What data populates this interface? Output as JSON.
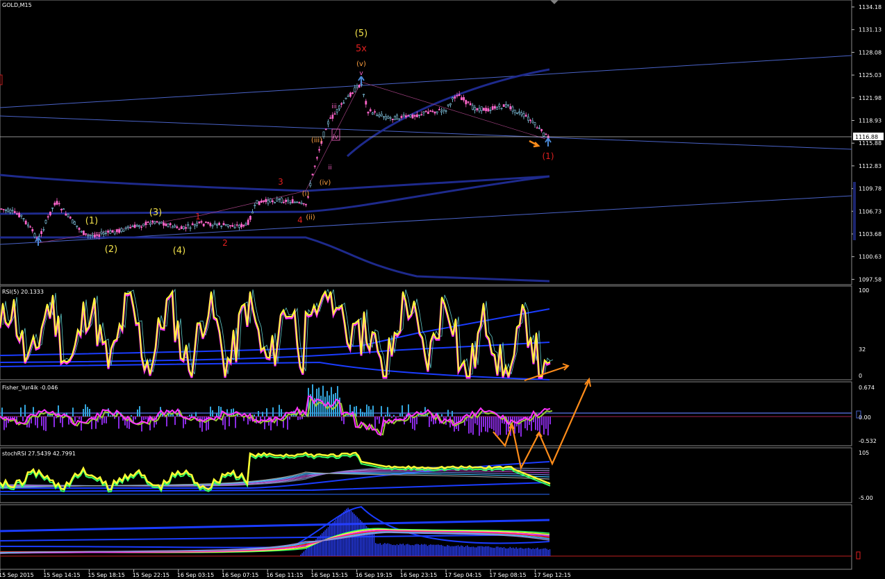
{
  "symbol_title": "GOLD,M15",
  "main_axis": [
    "1134.18",
    "1131.13",
    "1128.08",
    "1125.03",
    "1121.98",
    "1118.93",
    "1115.88",
    "1112.83",
    "1109.78",
    "1106.73",
    "1103.68",
    "1100.63",
    "1097.58"
  ],
  "current_price": "1116.88",
  "time_axis": [
    "15 Sep 2015",
    "15 Sep 14:15",
    "15 Sep 18:15",
    "15 Sep 22:15",
    "16 Sep 03:15",
    "16 Sep 07:15",
    "16 Sep 11:15",
    "16 Sep 15:15",
    "16 Sep 19:15",
    "16 Sep 23:15",
    "17 Sep 04:15",
    "17 Sep 08:15",
    "17 Sep 12:15"
  ],
  "rsi": {
    "title": "RSI(5) 20.1333",
    "axis": [
      "100",
      "32",
      "0"
    ]
  },
  "fisher": {
    "title": "Fisher_Yur4ik -0.046",
    "axis": [
      "0.674",
      "0.00",
      "-0.532"
    ]
  },
  "stochrsi": {
    "title": "stochRSI 27.5439 42.7991",
    "axis": [
      "105",
      "-5.00"
    ]
  },
  "wave_labels": {
    "y1": "(1)",
    "y2": "(2)",
    "y3": "(3)",
    "y4": "(4)",
    "y5": "(5)",
    "r5x": "5x",
    "o_v": "(v)",
    "o_iii": "(iii)",
    "o_iv": "(iv)",
    "o_i": "(i)",
    "o_ii": "(ii)",
    "p_iii": "iii",
    "p_iv": "iv",
    "p_ii": "ii",
    "p_v": "v",
    "p_vx": "v",
    "r1": "1",
    "r2": "2",
    "r3": "3",
    "r4": "4",
    "r_bottom1": "(1)"
  },
  "colors": {
    "background": "#000000",
    "price_up": "#87ceeb",
    "price_down": "#ff66cc",
    "channel": "#1e2a8c",
    "trendline": "#4a63c8",
    "rsi_main": "#ffff33",
    "rsi_shadow": "#ff33ff",
    "fisher_pos": "#33a6dd",
    "fisher_neg": "#8a2be2",
    "arrow": "#ff8c1a",
    "wave_yellow": "#f2e14a",
    "wave_red": "#e02020",
    "wave_orange": "#ffa040"
  }
}
